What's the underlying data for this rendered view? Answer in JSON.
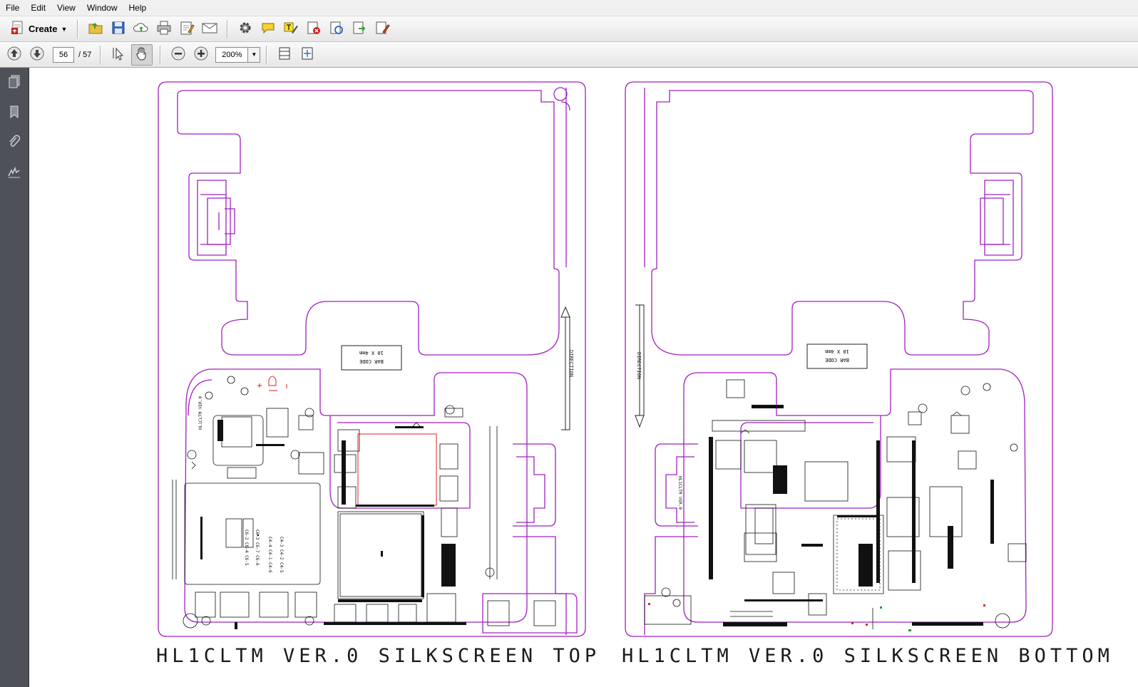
{
  "menu": [
    "File",
    "Edit",
    "View",
    "Window",
    "Help"
  ],
  "toolbar": {
    "create_label": "Create",
    "icons": [
      "open-icon",
      "save-icon",
      "upload-icon",
      "print-icon",
      "edit-form-icon",
      "email-icon",
      "settings-icon",
      "comment-icon",
      "highlight-icon",
      "delete-icon",
      "stamp-icon",
      "export-icon",
      "sign-icon"
    ]
  },
  "navigation": {
    "current_page": "56",
    "total_pages": "/ 57",
    "zoom": "200%"
  },
  "sidebar": {
    "icons": [
      "pages-icon",
      "bookmark-icon",
      "attachment-icon",
      "signature-icon"
    ]
  },
  "document": {
    "caption_left": "HL1CLTM VER.0 SILKSCREEN TOP",
    "caption_right": "HL1CLTM  VER.0 SILKSCREEN BOTTOM",
    "top": {
      "barcode_line1": "BAR CODE",
      "barcode_line2": "10 X 4mm",
      "direction": "DIRECTION",
      "board_label": "HL1CLTM VER.0"
    },
    "bottom": {
      "barcode_line1": "BAR CODE",
      "barcode_line2": "10 X 4mm",
      "direction": "DIRECTION",
      "board_label": "HL1CLTM VER.0"
    }
  },
  "colors": {
    "outline": "#a020c0",
    "accent_red": "#e02020",
    "ui_bar": "#ececec",
    "panel": "#4e5258"
  }
}
